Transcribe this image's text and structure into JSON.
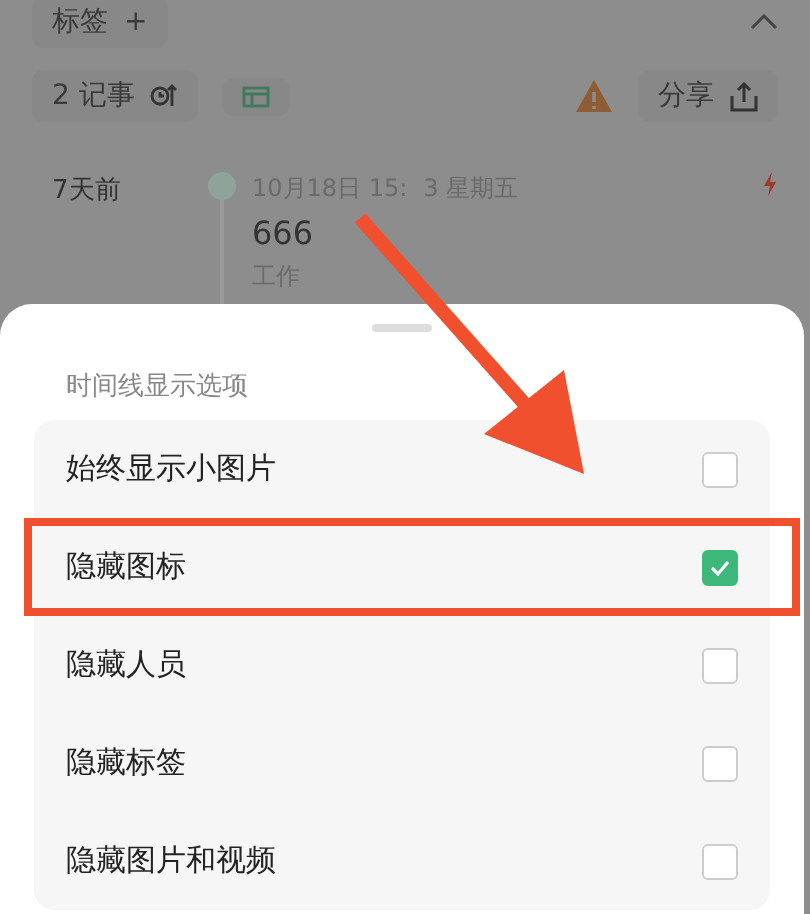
{
  "background": {
    "tag_chip": {
      "label": "标签",
      "add": "+"
    },
    "toolbar": {
      "count": "2 记事",
      "share": "分享"
    },
    "timeline": [
      {
        "age": "7天前",
        "date_before": "10月18日 15:",
        "date_after": "3 星期五",
        "title": "666",
        "tag": "工作"
      }
    ]
  },
  "sheet": {
    "title": "时间线显示选项",
    "options": [
      {
        "label": "始终显示小图片",
        "checked": false,
        "highlighted": false
      },
      {
        "label": "隐藏图标",
        "checked": true,
        "highlighted": true
      },
      {
        "label": "隐藏人员",
        "checked": false,
        "highlighted": false
      },
      {
        "label": "隐藏标签",
        "checked": false,
        "highlighted": false
      },
      {
        "label": "隐藏图片和视频",
        "checked": false,
        "highlighted": false
      }
    ]
  }
}
